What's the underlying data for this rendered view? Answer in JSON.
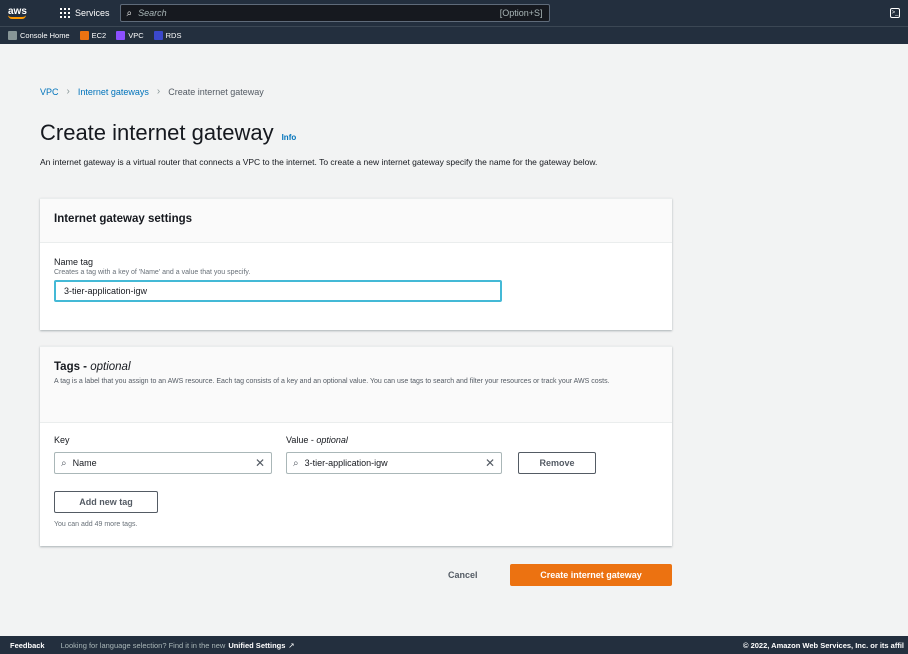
{
  "topnav": {
    "logo": "aws",
    "services_label": "Services",
    "search_placeholder": "Search",
    "search_shortcut": "[Option+S]",
    "favorites": [
      {
        "label": "Console Home",
        "color": "#879596"
      },
      {
        "label": "EC2",
        "color": "#ec7211"
      },
      {
        "label": "VPC",
        "color": "#8c4fff"
      },
      {
        "label": "RDS",
        "color": "#3b48cc"
      }
    ]
  },
  "breadcrumb": {
    "items": [
      "VPC",
      "Internet gateways"
    ],
    "current": "Create internet gateway"
  },
  "page": {
    "title": "Create internet gateway",
    "info_label": "Info",
    "description": "An internet gateway is a virtual router that connects a VPC to the internet. To create a new internet gateway specify the name for the gateway below."
  },
  "settings": {
    "title": "Internet gateway settings",
    "name_tag_label": "Name tag",
    "name_tag_desc": "Creates a tag with a key of 'Name' and a value that you specify.",
    "name_tag_value": "3-tier-application-igw"
  },
  "tags": {
    "title": "Tags - ",
    "title_optional": "optional",
    "description": "A tag is a label that you assign to an AWS resource. Each tag consists of a key and an optional value. You can use tags to search and filter your resources or track your AWS costs.",
    "key_label": "Key",
    "value_label": "Value - ",
    "value_optional": "optional",
    "key_value": "Name",
    "value_value": "3-tier-application-igw",
    "remove_label": "Remove",
    "add_label": "Add new tag",
    "limit_text": "You can add 49 more tags."
  },
  "actions": {
    "cancel_label": "Cancel",
    "create_label": "Create internet gateway"
  },
  "footer": {
    "feedback": "Feedback",
    "message": "Looking for language selection? Find it in the new",
    "unified": "Unified Settings",
    "copyright": "© 2022, Amazon Web Services, Inc. or its affil"
  },
  "colors": {
    "nav_bg": "#232f3e",
    "primary": "#ec7211",
    "link": "#0073bb",
    "focus": "#44b9d6"
  }
}
